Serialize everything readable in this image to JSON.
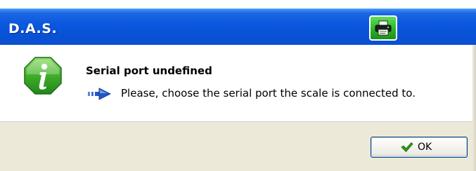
{
  "window": {
    "title": "D.A.S.",
    "title_button_icon": "printer-icon"
  },
  "message": {
    "icon": "info-icon",
    "heading": "Serial port undefined",
    "bullet_icon": "arrow-right-icon",
    "detail": "Please, choose the serial port the scale is connected to."
  },
  "footer": {
    "ok_icon": "checkmark-icon",
    "ok_label": "OK"
  },
  "colors": {
    "titlebar": "#0a58df",
    "title_button": "#2db229",
    "info_icon": "#3fae2a",
    "arrow": "#2457c5",
    "checkmark": "#2f9a14",
    "dialog_bg": "#ece9d8"
  }
}
